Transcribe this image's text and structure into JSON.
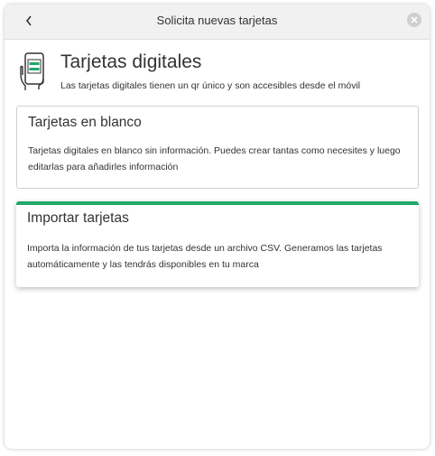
{
  "header": {
    "title": "Solicita nuevas tarjetas",
    "back_icon": "chevron-left-icon",
    "close_icon": "close-icon"
  },
  "hero": {
    "icon": "phone-card-icon",
    "title": "Tarjetas digitales",
    "subtitle": "Las tarjetas digitales tienen un qr único y son accesibles desde el móvil"
  },
  "options": [
    {
      "title": "Tarjetas en blanco",
      "description": "Tarjetas digitales en blanco sin información. Puedes crear tantas como necesites y luego editarlas para añadirles información",
      "selected": false
    },
    {
      "title": "Importar tarjetas",
      "description": "Importa la información de tus tarjetas desde un archivo CSV. Generamos las tarjetas automáticamente y las tendrás disponibles en tu marca",
      "selected": true
    }
  ],
  "colors": {
    "accent": "#20a868",
    "header_bg": "#f1f1f1"
  }
}
